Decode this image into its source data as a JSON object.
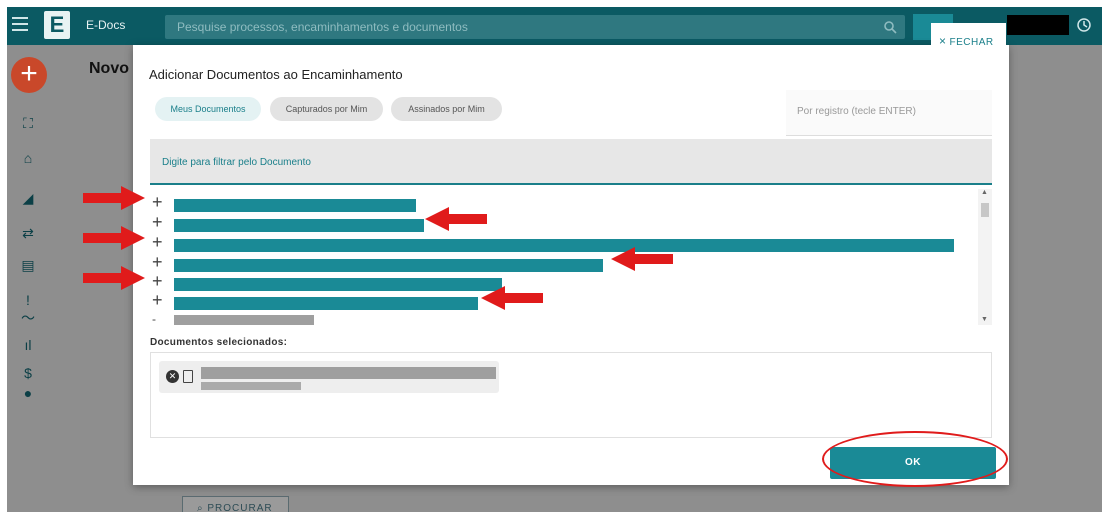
{
  "app": {
    "name": "E-Docs",
    "logo_letter": "E"
  },
  "search": {
    "placeholder": "Pesquise processos, encaminhamentos e documentos"
  },
  "page": {
    "title": "Novo",
    "procurar_label": "PROCURAR"
  },
  "modal": {
    "title": "Adicionar Documentos ao Encaminhamento",
    "close_label": "FECHAR",
    "tabs": [
      {
        "label": "Meus Documentos",
        "active": true
      },
      {
        "label": "Capturados por Mim",
        "active": false
      },
      {
        "label": "Assinados por Mim",
        "active": false
      }
    ],
    "registro_placeholder": "Por registro (tecle ENTER)",
    "filter_placeholder": "Digite para filtrar pelo Documento",
    "documents": [
      {
        "icon": "plus-icon",
        "bar_fraction": 0.31
      },
      {
        "icon": "plus-icon",
        "bar_fraction": 0.32
      },
      {
        "icon": "plus-icon",
        "bar_fraction": 1.0
      },
      {
        "icon": "plus-icon",
        "bar_fraction": 0.55
      },
      {
        "icon": "plus-icon",
        "bar_fraction": 0.42
      },
      {
        "icon": "plus-icon",
        "bar_fraction": 0.39
      }
    ],
    "selected_label": "Documentos selecionados:",
    "ok_label": "OK"
  },
  "colors": {
    "primary": "#1a8a96",
    "topbar": "#0b5a63",
    "fab": "#c9482a",
    "annotation": "#e01b1b",
    "redacted": "#9f9f9f"
  }
}
